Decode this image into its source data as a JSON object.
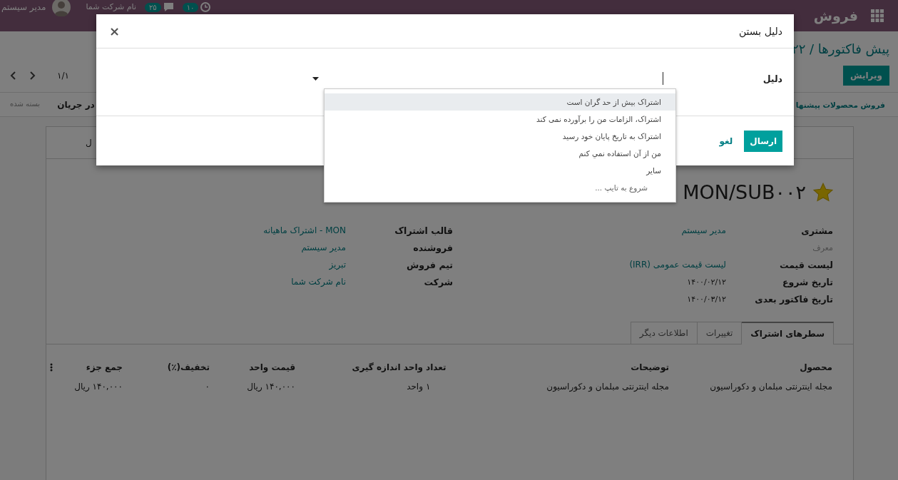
{
  "topbar": {
    "app": "فروش",
    "user": "مدیر سیستم",
    "company": "نام شرکت شما",
    "badges": [
      {
        "count": "۱۰",
        "kind": "clock"
      },
      {
        "count": "۲۵",
        "kind": "chat"
      }
    ]
  },
  "breadcrumb": "پیش فاکتورها / ۲۲",
  "edit_button": "ویرایش",
  "pager": "۱/۱",
  "header_button": "فروش محصولات پیشنها",
  "stages": [
    {
      "label": "در جریان",
      "selected": true
    },
    {
      "label": "بسته شده",
      "selected": false
    }
  ],
  "stat_button": "ل",
  "record": {
    "starred": true,
    "name": "MON/SUB۰۰۲"
  },
  "fields_right": [
    {
      "label": "مشتری",
      "value": "مدیر سیستم",
      "kind": "link"
    },
    {
      "label": "معرف",
      "kind": "empty"
    },
    {
      "label": "لیست قیمت",
      "value": "لیست قیمت عمومی (IRR)",
      "kind": "link"
    },
    {
      "label": "تاریخ شروع",
      "value": "۱۴۰۰/۰۲/۱۲",
      "kind": "text"
    },
    {
      "label": "تاریخ فاکتور بعدی",
      "value": "۱۴۰۰/۰۳/۱۲",
      "kind": "text"
    }
  ],
  "fields_left": [
    {
      "label": "قالب اشتراک",
      "value": "MON - اشتراک ماهیانه",
      "kind": "link"
    },
    {
      "label": "فروشنده",
      "value": "مدیر سیستم",
      "kind": "link"
    },
    {
      "label": "تیم فروش",
      "value": "تبریز",
      "kind": "link"
    },
    {
      "label": "شرکت",
      "value": "نام شرکت شما",
      "kind": "link"
    }
  ],
  "tabs": [
    {
      "label": "سطرهای اشتراک",
      "selected": true
    },
    {
      "label": "تغییرات",
      "selected": false
    },
    {
      "label": "اطلاعات دیگر",
      "selected": false
    }
  ],
  "table": {
    "columns": [
      "محصول",
      "توضیحات",
      "تعداد",
      "واحد اندازه گیری",
      "قیمت واحد",
      "تخفیف(٪)",
      "جمع جزء"
    ],
    "rows": [
      [
        "مجله اینترنتی مبلمان و دکوراسیون",
        "مجله اینترنتی مبلمان و دکوراسیون",
        "۱",
        "واحد",
        "۱۴۰,۰۰۰ ریال",
        "۰",
        "۱۴۰,۰۰۰ ریال"
      ]
    ]
  },
  "dialog": {
    "title": "دلیل بستن",
    "close": "×",
    "field_label": "دلیل",
    "options": [
      {
        "label": "اشتراک بیش از حد گران است",
        "selected": true
      },
      {
        "label": "اشتراک، الزامات من را برآورده نمی کند",
        "selected": false
      },
      {
        "label": "اشتراک به تاریخ پایان خود رسید",
        "selected": false
      },
      {
        "label": "من از آن استفاده نمي كنم",
        "selected": false
      },
      {
        "label": "سایر",
        "selected": false
      }
    ],
    "hint": "شروع به تایپ ...",
    "buttons": [
      {
        "label": "ارسال",
        "kind": "primary"
      },
      {
        "label": "لغو",
        "kind": "link"
      }
    ]
  }
}
